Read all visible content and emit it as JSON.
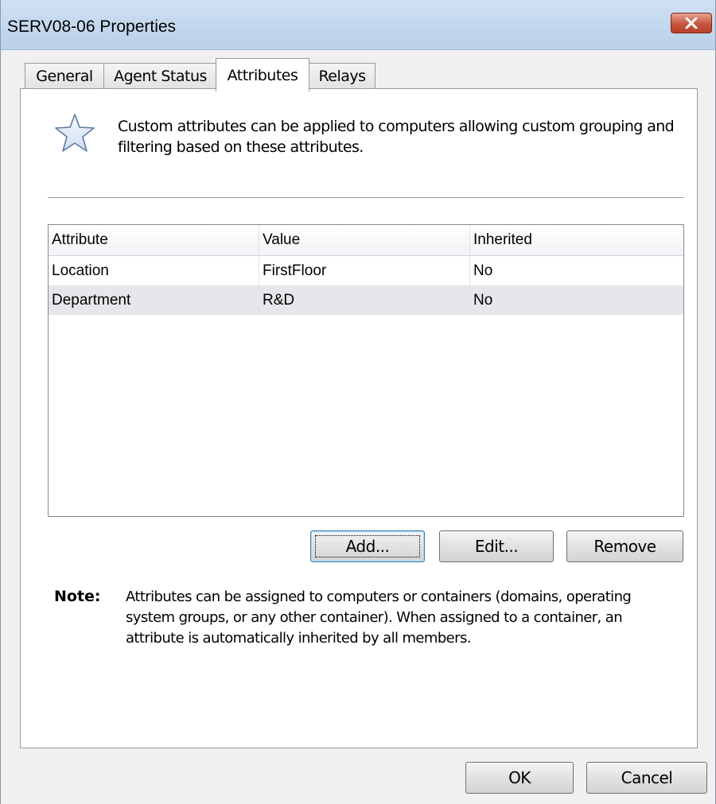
{
  "window": {
    "title": "SERV08-06 Properties",
    "close_label": "✕"
  },
  "tabs": [
    {
      "label": "General",
      "active": false
    },
    {
      "label": "Agent Status",
      "active": false
    },
    {
      "label": "Attributes",
      "active": true
    },
    {
      "label": "Relays",
      "active": false
    }
  ],
  "attributes_tab": {
    "icon": "star-icon",
    "description": "Custom attributes can be applied to computers allowing custom grouping and filtering based on these attributes.",
    "list": {
      "columns": [
        "Attribute",
        "Value",
        "Inherited"
      ],
      "rows": [
        {
          "attribute": "Location",
          "value": "FirstFloor",
          "inherited": "No"
        },
        {
          "attribute": "Department",
          "value": "R&D",
          "inherited": "No"
        }
      ]
    },
    "buttons": {
      "add": "Add...",
      "edit": "Edit...",
      "remove": "Remove"
    },
    "note_label": "Note:",
    "note_text": "Attributes can be assigned to computers or containers (domains, operating system groups, or any other container). When assigned to a container, an attribute is automatically inherited by all members."
  },
  "footer": {
    "ok": "OK",
    "cancel": "Cancel"
  },
  "colors": {
    "titlebar": "#c4d8ee",
    "close_button": "#c7553c",
    "panel": "#ffffff",
    "alt_row": "#e6e7ea"
  }
}
